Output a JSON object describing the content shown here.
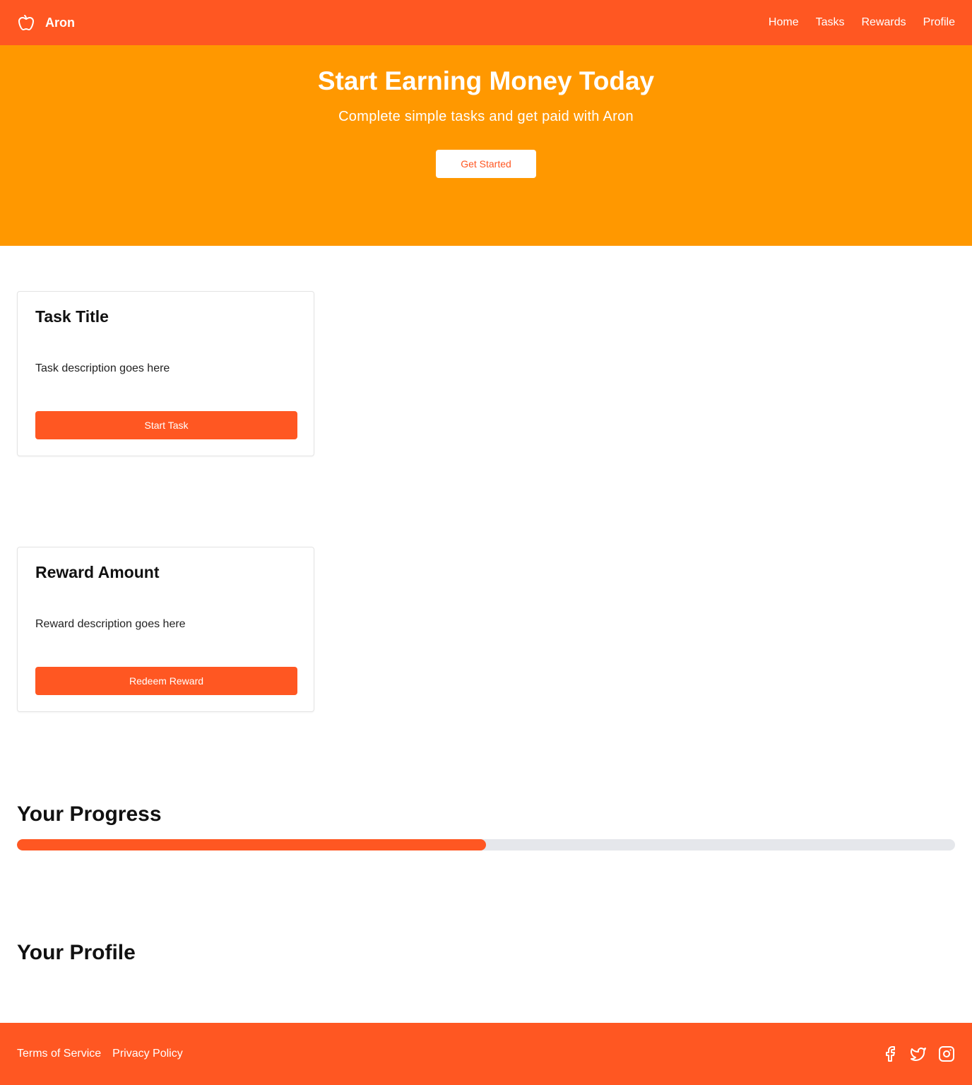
{
  "header": {
    "brand_name": "Aron",
    "logo_icon": "apple-icon",
    "nav": [
      {
        "label": "Home"
      },
      {
        "label": "Tasks"
      },
      {
        "label": "Rewards"
      },
      {
        "label": "Profile"
      }
    ]
  },
  "hero": {
    "title": "Start Earning Money Today",
    "subtitle": "Complete simple tasks and get paid with Aron",
    "button_label": "Get Started"
  },
  "task_card": {
    "title": "Task Title",
    "description": "Task description goes here",
    "button_label": "Start Task"
  },
  "reward_card": {
    "title": "Reward Amount",
    "description": "Reward description goes here",
    "button_label": "Redeem Reward"
  },
  "progress": {
    "title": "Your Progress",
    "value_percent": 50
  },
  "profile": {
    "title": "Your Profile"
  },
  "footer": {
    "links": [
      {
        "label": "Terms of Service"
      },
      {
        "label": "Privacy Policy"
      }
    ],
    "social_icons": [
      "facebook-icon",
      "twitter-icon",
      "instagram-icon"
    ]
  },
  "colors": {
    "primary": "#ff5722",
    "hero_bg": "#ff9800",
    "track": "#e5e7eb"
  }
}
